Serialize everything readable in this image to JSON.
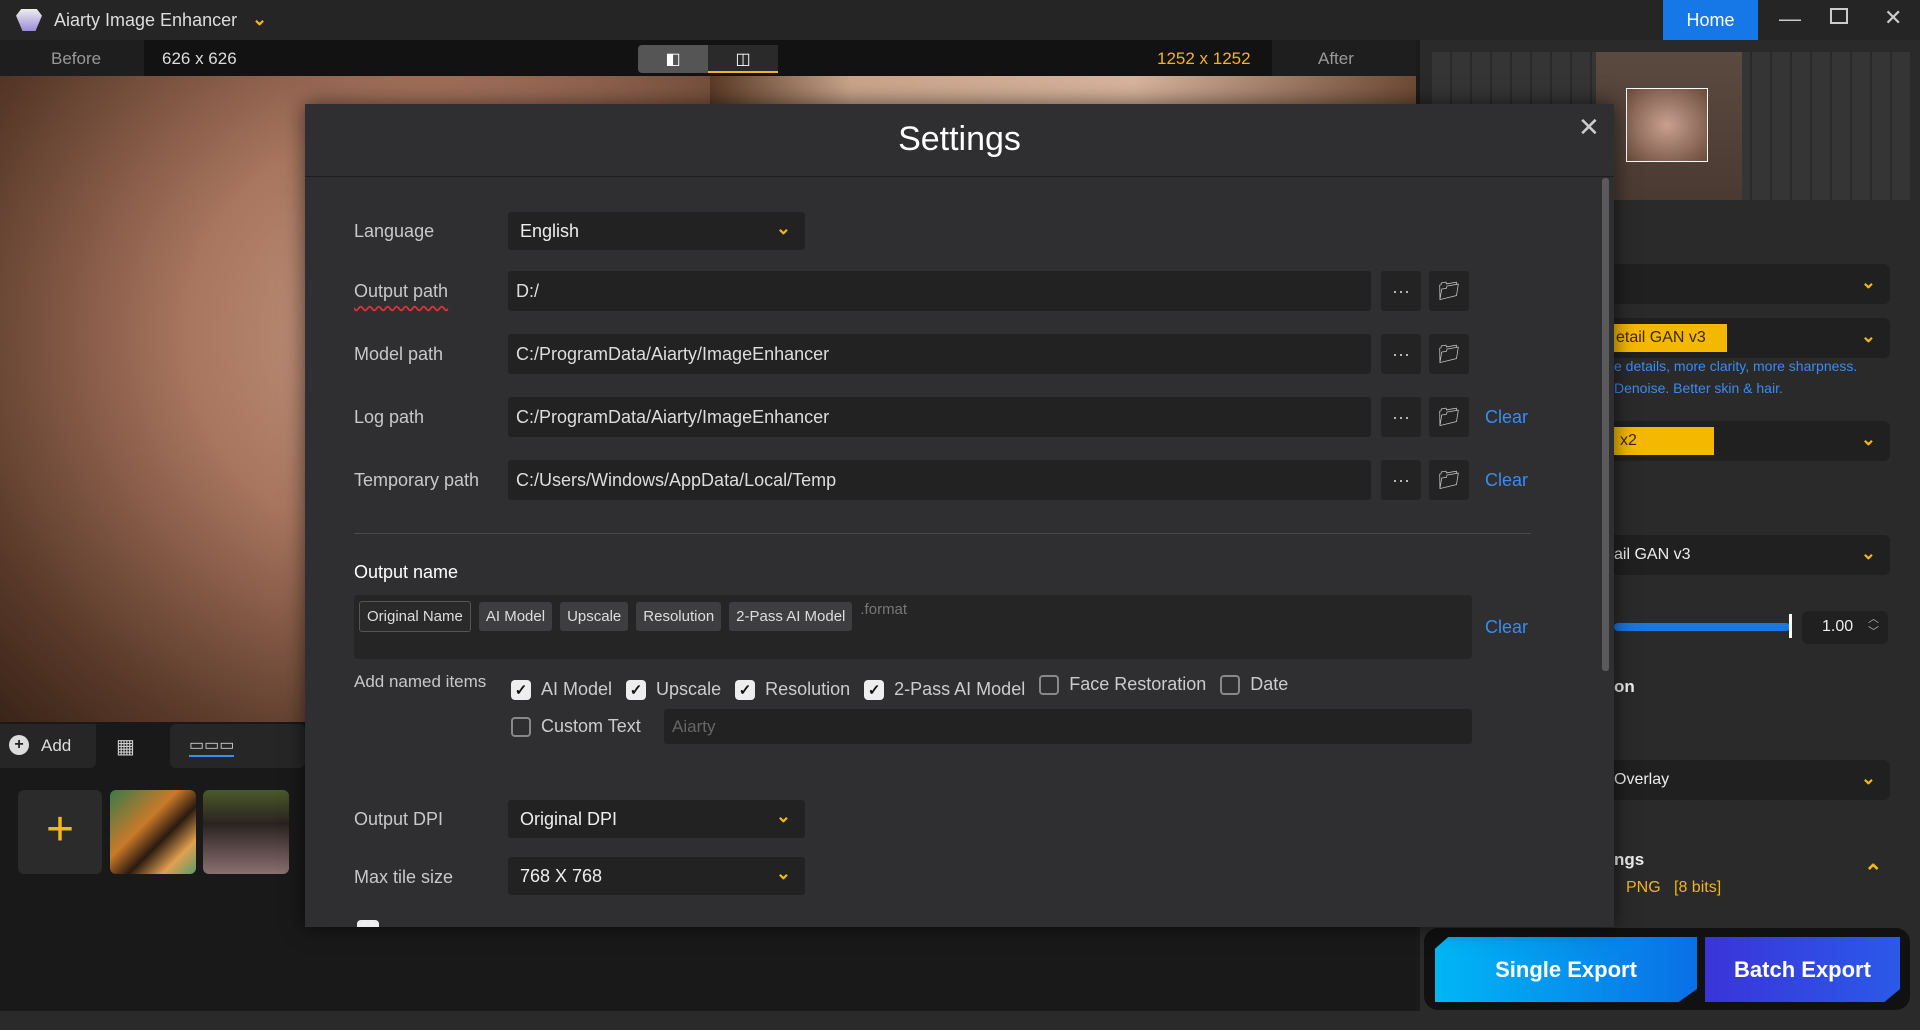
{
  "app": {
    "title": "Aiarty Image Enhancer",
    "home": "Home"
  },
  "toolbar": {
    "before": "Before",
    "before_size": "626 x 626",
    "after_size": "1252 x 1252",
    "after": "After"
  },
  "bottom": {
    "add": "Add"
  },
  "right_panel": {
    "model_fragment": "etail GAN  v3",
    "desc1": "e details, more clarity, more sharpness.",
    "desc2": "Denoise. Better skin & hair.",
    "scale": "x2",
    "model2_fragment": "ail GAN  v3",
    "strength": "1.00",
    "section_fragment": "on",
    "overlay": "Overlay",
    "settings_fragment": "ngs",
    "format": "PNG   [8 bits]",
    "single_export": "Single Export",
    "batch_export": "Batch Export"
  },
  "settings": {
    "title": "Settings",
    "language_label": "Language",
    "language": "English",
    "paths": [
      {
        "label": "Output path",
        "value": "D:/",
        "clear": ""
      },
      {
        "label": "Model path",
        "value": "C:/ProgramData/Aiarty/ImageEnhancer",
        "clear": ""
      },
      {
        "label": "Log path",
        "value": "C:/ProgramData/Aiarty/ImageEnhancer",
        "clear": "Clear"
      },
      {
        "label": "Temporary path",
        "value": "C:/Users/Windows/AppData/Local/Temp",
        "clear": "Clear"
      }
    ],
    "output_name_label": "Output name",
    "chips": [
      "Original Name",
      "AI Model",
      "Upscale",
      "Resolution",
      "2-Pass AI Model"
    ],
    "format_suffix": ".format",
    "clear": "Clear",
    "add_named_items_label": "Add named items",
    "named_items": [
      {
        "label": "AI Model",
        "checked": true
      },
      {
        "label": "Upscale",
        "checked": true
      },
      {
        "label": "Resolution",
        "checked": true
      },
      {
        "label": "2-Pass AI Model",
        "checked": true
      },
      {
        "label": "Face Restoration",
        "checked": false
      },
      {
        "label": "Date",
        "checked": false
      }
    ],
    "custom_text_label": "Custom Text",
    "custom_text_placeholder": "Aiarty",
    "dpi_label": "Output DPI",
    "dpi": "Original DPI",
    "tile_label": "Max tile size",
    "tile": "768 X 768"
  },
  "colors": {
    "accent": "#1677e6",
    "yellow": "#f2b51a",
    "link": "#3a8cf0"
  }
}
